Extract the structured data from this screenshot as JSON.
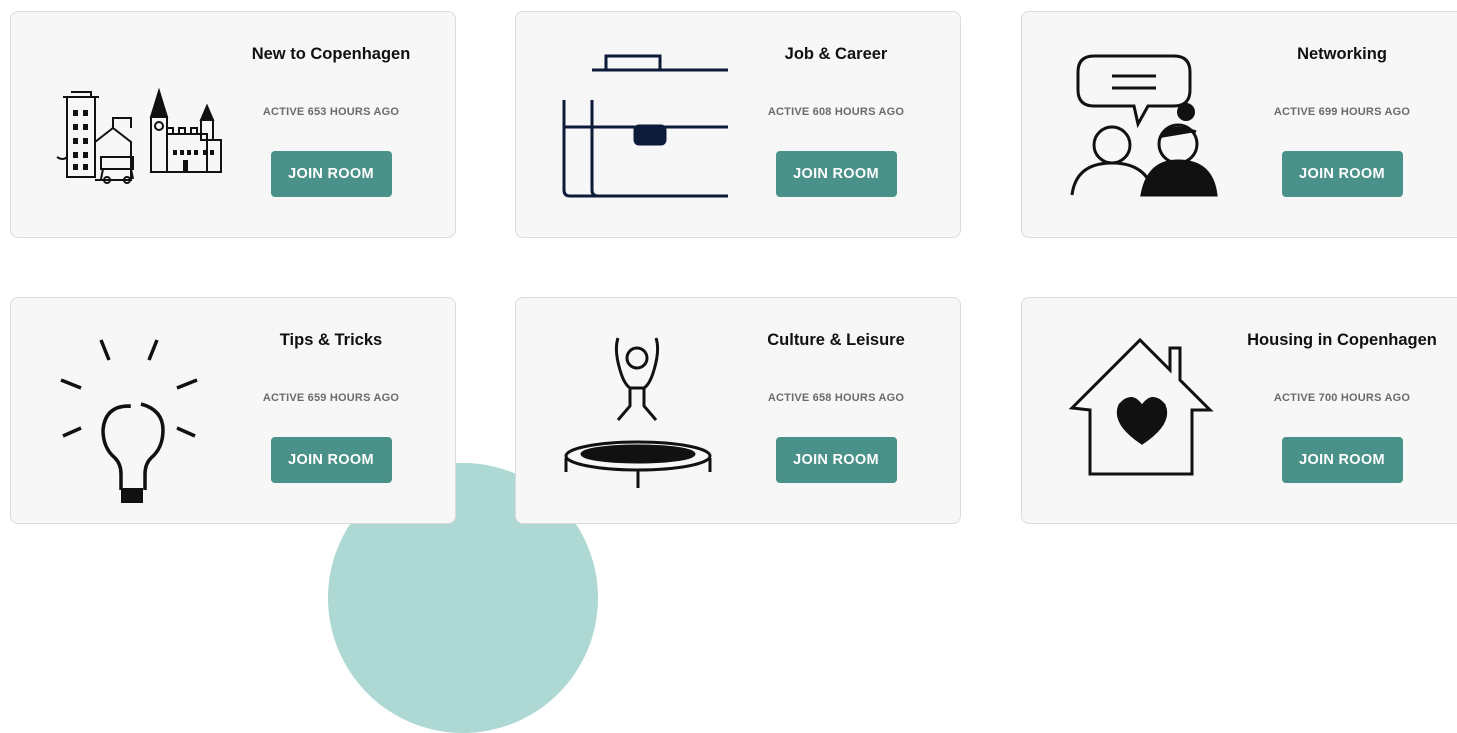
{
  "rooms": [
    {
      "title": "New to Copenhagen",
      "activity": "ACTIVE 653 HOURS AGO",
      "button": "JOIN ROOM",
      "icon": "city-skyline-icon"
    },
    {
      "title": "Job & Career",
      "activity": "ACTIVE 608 HOURS AGO",
      "button": "JOIN ROOM",
      "icon": "briefcase-icon"
    },
    {
      "title": "Networking",
      "activity": "ACTIVE 699 HOURS AGO",
      "button": "JOIN ROOM",
      "icon": "people-chat-icon"
    },
    {
      "title": "Tips & Tricks",
      "activity": "ACTIVE 659 HOURS AGO",
      "button": "JOIN ROOM",
      "icon": "lightbulb-icon"
    },
    {
      "title": "Culture & Leisure",
      "activity": "ACTIVE 658 HOURS AGO",
      "button": "JOIN ROOM",
      "icon": "trampoline-icon"
    },
    {
      "title": "Housing in Copenhagen",
      "activity": "ACTIVE 700 HOURS AGO",
      "button": "JOIN ROOM",
      "icon": "house-heart-icon"
    }
  ],
  "colors": {
    "button": "#4a9189",
    "card_background": "#f7f7f7",
    "decor_circle": "#a9d6d1"
  }
}
